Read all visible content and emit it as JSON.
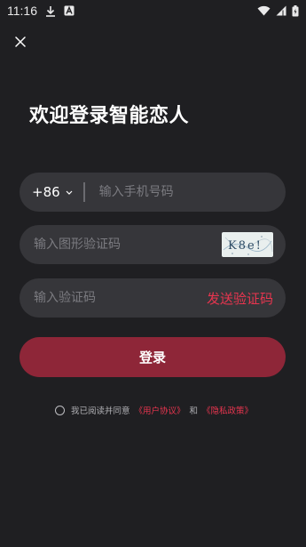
{
  "status_bar": {
    "time": "11:16",
    "icons": [
      "download-icon",
      "app-notification-icon",
      "wifi-icon",
      "cellular-signal-icon",
      "battery-icon"
    ]
  },
  "header": {
    "close_icon": "close-icon"
  },
  "title": "欢迎登录智能恋人",
  "phone": {
    "country_code": "+86",
    "placeholder": "输入手机号码",
    "value": ""
  },
  "captcha": {
    "placeholder": "输入图形验证码",
    "value": "",
    "image_text": "K8e!"
  },
  "sms_code": {
    "placeholder": "输入验证码",
    "value": "",
    "send_label": "发送验证码"
  },
  "login_button": "登录",
  "agreement": {
    "prefix": "我已阅读并同意",
    "user_agreement": "《用户协议》",
    "and": "和",
    "privacy_policy": "《隐私政策》",
    "checked": false
  },
  "colors": {
    "background": "#1f1f22",
    "field": "#36363a",
    "accent": "#e8354f",
    "primary_button": "#8e2638"
  }
}
